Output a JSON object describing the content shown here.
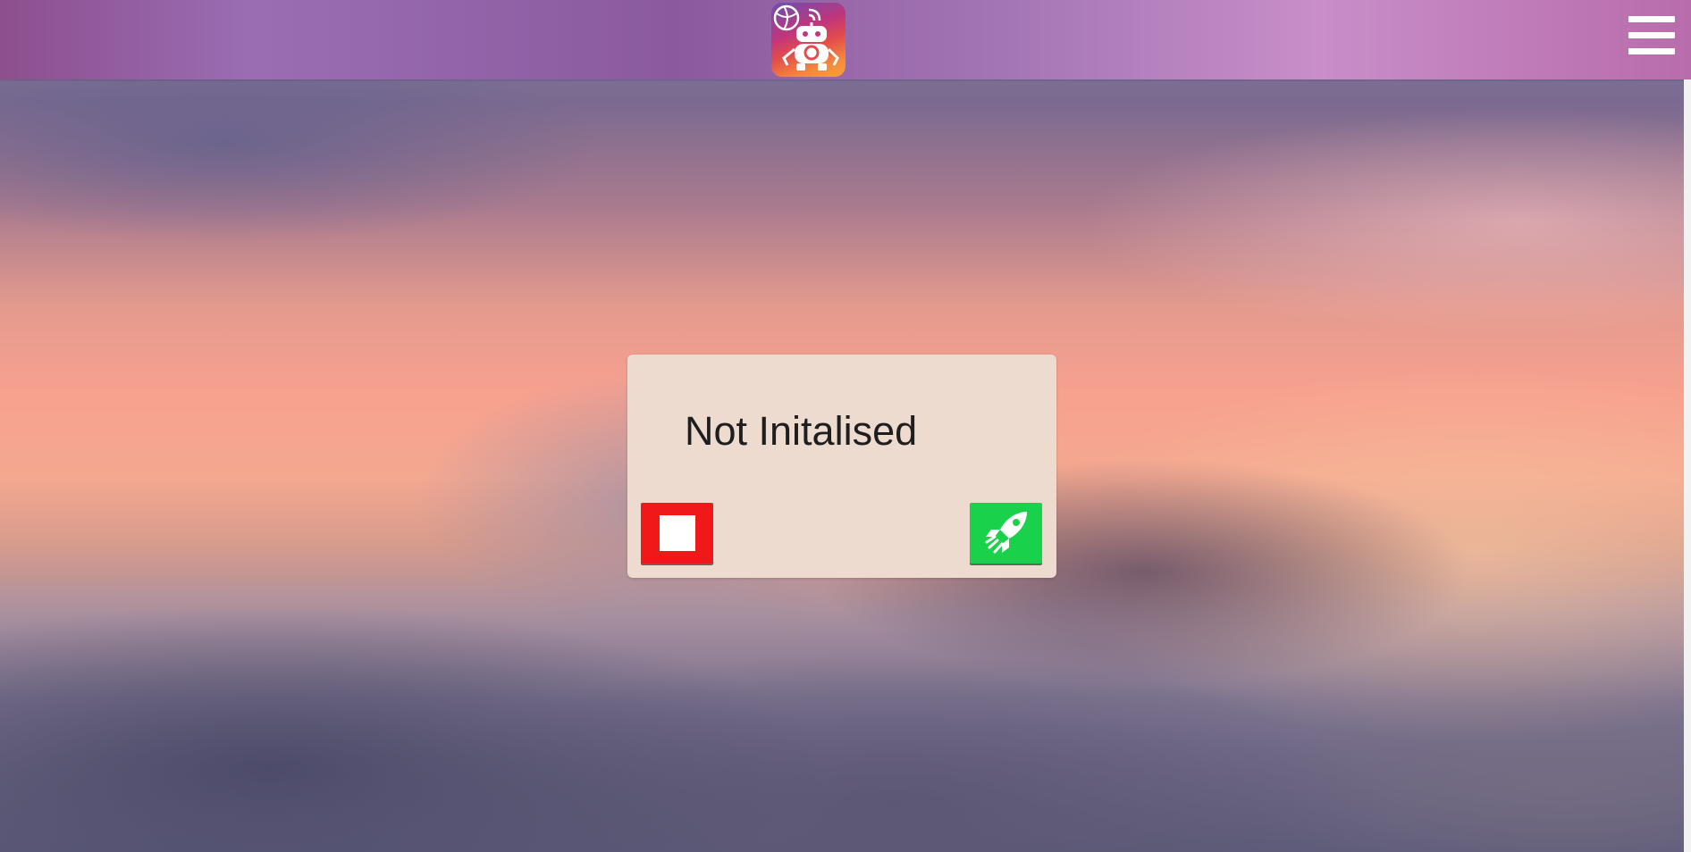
{
  "header": {
    "logo_icon": "robot-logo-icon",
    "menu_icon": "hamburger-menu-icon"
  },
  "status_panel": {
    "status_text": "Not Initalised",
    "stop_button": {
      "icon": "stop-square-icon",
      "color": "#f01818"
    },
    "start_button": {
      "icon": "rocket-icon",
      "color": "#19d14a"
    }
  },
  "colors": {
    "panel_background": "#eedbd0",
    "topbar_accent": "#9a6db3"
  }
}
